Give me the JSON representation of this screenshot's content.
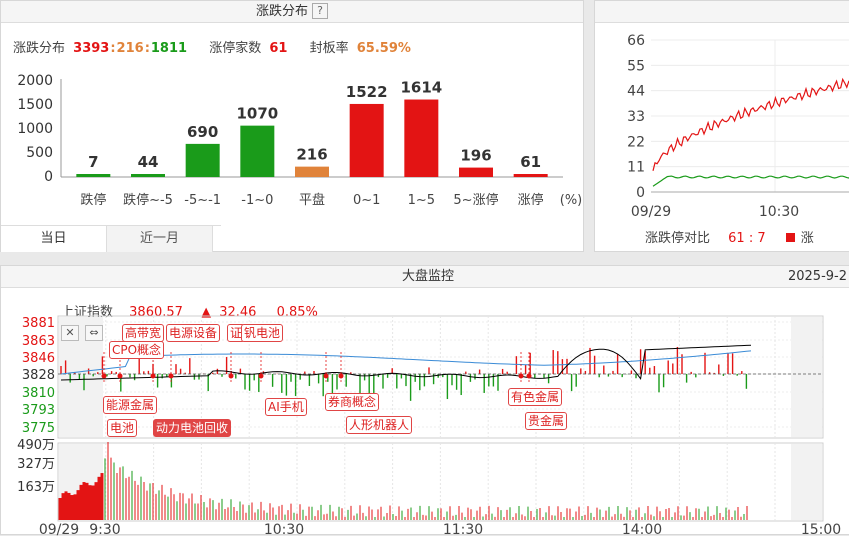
{
  "dist_panel": {
    "title": "涨跌分布",
    "help": "?",
    "stats": {
      "updown_label": "涨跌分布",
      "up": "3393",
      "colon1": ":",
      "flat": "216",
      "colon2": ":",
      "down": "1811",
      "limitup_label": "涨停家数",
      "limitup": "61",
      "seal_label": "封板率",
      "seal": "65.59%"
    },
    "tabs": [
      "当日",
      "近一月"
    ]
  },
  "chart_data": {
    "type": "bar",
    "categories": [
      "跌停",
      "跌停~-5",
      "-5~-1",
      "-1~0",
      "平盘",
      "0~1",
      "1~5",
      "5~涨停",
      "涨停"
    ],
    "values": [
      7,
      44,
      690,
      1070,
      216,
      1522,
      1614,
      196,
      61
    ],
    "colors": [
      "#1a9b1a",
      "#1a9b1a",
      "#1a9b1a",
      "#1a9b1a",
      "#e0833a",
      "#e31414",
      "#e31414",
      "#e31414",
      "#e31414"
    ],
    "y_ticks": [
      "2000",
      "1500",
      "1000",
      "500",
      "0"
    ],
    "ylim": [
      0,
      2000
    ],
    "unit": "(%)"
  },
  "limit_panel": {
    "y_ticks": [
      "66",
      "55",
      "44",
      "33",
      "22",
      "11",
      "0"
    ],
    "x_ticks": [
      "09/29",
      "10:30"
    ],
    "legend_label": "涨跌停对比",
    "legend_up": "61",
    "legend_colon": ":",
    "legend_down": "7",
    "legend_extra": "涨"
  },
  "market_panel": {
    "title": "大盘监控",
    "date": "2025-9-2",
    "index_name": "上证指数",
    "index_value": "3860.57",
    "arrow": "▲",
    "change": "32.46",
    "change_pct": "0.85%",
    "price_ticks_red": [
      "3881",
      "3863",
      "3846"
    ],
    "price_tick_mid": "3828",
    "price_ticks_green": [
      "3810",
      "3793",
      "3775"
    ],
    "volume_ticks": [
      "490万",
      "327万",
      "163万"
    ],
    "time_ticks": [
      "09/29",
      "9:30",
      "10:30",
      "11:30",
      "14:00",
      "15:00"
    ],
    "tags": {
      "t1": "高带宽",
      "t2": "电源设备",
      "t3": "证",
      "t4": "钒电池",
      "t5": "CPO概念",
      "t6": "能源金属",
      "t7": "电池",
      "t8": "动力电池回收",
      "t9": "AI手机",
      "t10": "券商概念",
      "t11": "人形机器人",
      "t12": "有色金属",
      "t13": "贵金属"
    },
    "ctrl_close": "✕",
    "ctrl_expand": "⇔"
  },
  "colors": {
    "up": "#e31414",
    "down": "#1a9b1a",
    "flat": "#e0833a",
    "index_line": "#000000",
    "avg_line": "#3a8bd6"
  }
}
